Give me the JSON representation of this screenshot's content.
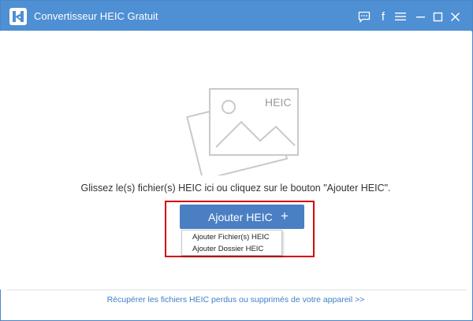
{
  "window": {
    "title": "Convertisseur HEIC Gratuit",
    "icons": {
      "logo": "heic-app-logo-icon",
      "feedback": "chat-feedback-icon",
      "facebook": "facebook-icon",
      "menu": "hamburger-menu-icon",
      "minimize": "minimize-icon",
      "maximize": "maximize-icon",
      "close": "close-icon"
    },
    "facebook_glyph": "f",
    "accent_color": "#4f8fd3"
  },
  "main": {
    "illustration_label": "HEIC",
    "instruction": "Glissez le(s) fichier(s) HEIC ici ou cliquez sur le bouton \"Ajouter HEIC\".",
    "add_button": {
      "label": "Ajouter HEIC",
      "plus": "+",
      "color": "#4a7fc4"
    },
    "dropdown_items": [
      {
        "label": "Ajouter Fichier(s) HEIC"
      },
      {
        "label": "Ajouter Dossier HEIC"
      }
    ],
    "highlight_color": "#d40000"
  },
  "footer": {
    "link_text": "Récupérer les fichiers HEIC perdus ou supprimés de votre appareil >>",
    "link_color": "#3f7fc6"
  }
}
